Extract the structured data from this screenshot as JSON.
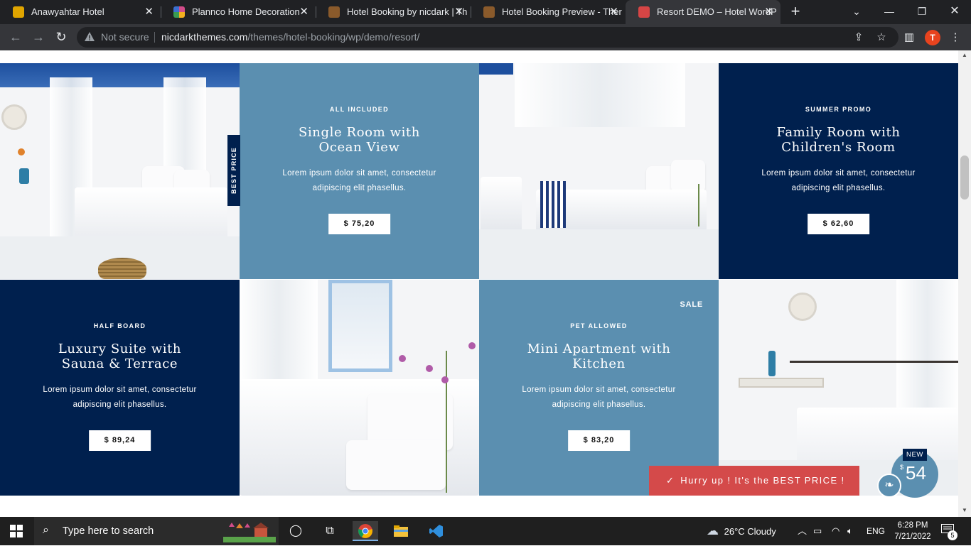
{
  "browser": {
    "tabs": [
      {
        "label": "Anawyahtar Hotel",
        "favicon_color": "#e0a500"
      },
      {
        "label": "Plannco Home Decoration",
        "favicon_color": "#d24c8a"
      },
      {
        "label": "Hotel Booking by nicdark | Th",
        "favicon_color": "#8a5a2b"
      },
      {
        "label": "Hotel Booking Preview - Ther",
        "favicon_color": "#8a5a2b"
      },
      {
        "label": "Resort DEMO – Hotel WordP",
        "favicon_color": "#d64545",
        "active": true
      }
    ],
    "security_label": "Not secure",
    "url_host": "nicdarkthemes.com",
    "url_path": "/themes/hotel-booking/wp/demo/resort/",
    "profile_initial": "T"
  },
  "rooms": [
    {
      "tag": "ALL INCLUDED",
      "title": "Single Room with Ocean View",
      "desc": "Lorem ipsum dolor sit amet, consectetur adipiscing elit phasellus.",
      "price": "$ 75,20"
    },
    {
      "tag": "SUMMER PROMO",
      "title": "Family Room with Children's Room",
      "desc": "Lorem ipsum dolor sit amet, consectetur adipiscing elit phasellus.",
      "price": "$ 62,60"
    },
    {
      "tag": "HALF BOARD",
      "title": "Luxury Suite with Sauna & Terrace",
      "desc": "Lorem ipsum dolor sit amet, consectetur adipiscing elit phasellus.",
      "price": "$ 89,24"
    },
    {
      "tag": "PET ALLOWED",
      "title": "Mini Apartment with Kitchen",
      "desc": "Lorem ipsum dolor sit amet, consectetur adipiscing elit phasellus.",
      "price": "$ 83,20",
      "badge": "SALE"
    }
  ],
  "best_price_ribbon": "BEST PRICE",
  "notice": {
    "check": "✓",
    "text": "Hurry up ! It's the BEST PRICE !"
  },
  "cart_bubble": {
    "badge": "NEW",
    "currency": "$",
    "amount": "54"
  },
  "colors": {
    "blue": "#5b8fb0",
    "navy": "#00204e",
    "notice_red": "#d44a4a"
  },
  "taskbar": {
    "search_placeholder": "Type here to search",
    "weather": "26°C  Cloudy",
    "language": "ENG",
    "time": "6:28 PM",
    "date": "7/21/2022",
    "notifications": "5"
  }
}
